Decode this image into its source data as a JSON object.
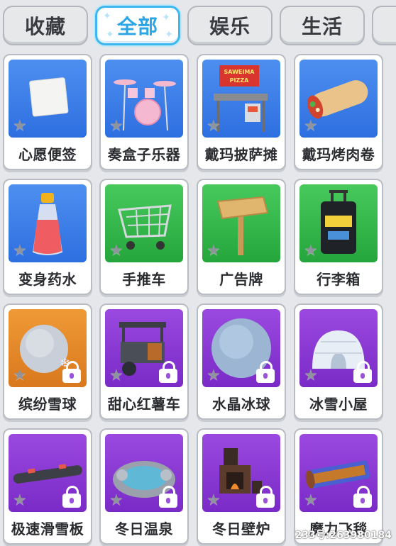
{
  "tabs": [
    {
      "label": "收藏",
      "active": false
    },
    {
      "label": "全部",
      "active": true
    },
    {
      "label": "娱乐",
      "active": false
    },
    {
      "label": "生活",
      "active": false
    }
  ],
  "items": [
    {
      "label": "心愿便签",
      "bg": "blue",
      "icon": "note-paper-icon",
      "locked": false
    },
    {
      "label": "奏盒子乐器",
      "bg": "blue",
      "icon": "drum-kit-icon",
      "locked": false
    },
    {
      "label": "戴玛披萨摊",
      "bg": "blue",
      "icon": "pizza-stand-icon",
      "locked": false,
      "sign_text": "SAWEIMA PIZZA"
    },
    {
      "label": "戴玛烤肉卷",
      "bg": "blue",
      "icon": "burrito-icon",
      "locked": false
    },
    {
      "label": "变身药水",
      "bg": "blue",
      "icon": "potion-bottle-icon",
      "locked": false
    },
    {
      "label": "手推车",
      "bg": "green",
      "icon": "shopping-cart-icon",
      "locked": false
    },
    {
      "label": "广告牌",
      "bg": "green",
      "icon": "signboard-icon",
      "locked": false
    },
    {
      "label": "行李箱",
      "bg": "green",
      "icon": "suitcase-icon",
      "locked": false
    },
    {
      "label": "缤纷雪球",
      "bg": "orange",
      "icon": "snowball-icon",
      "locked": true
    },
    {
      "label": "甜心红薯车",
      "bg": "purple",
      "icon": "sweet-potato-cart-icon",
      "locked": true
    },
    {
      "label": "水晶冰球",
      "bg": "purple",
      "icon": "crystal-ice-ball-icon",
      "locked": true
    },
    {
      "label": "冰雪小屋",
      "bg": "purple",
      "icon": "igloo-icon",
      "locked": true
    },
    {
      "label": "极速滑雪板",
      "bg": "purple",
      "icon": "snowboard-icon",
      "locked": true
    },
    {
      "label": "冬日温泉",
      "bg": "purple",
      "icon": "hot-spring-icon",
      "locked": true
    },
    {
      "label": "冬日壁炉",
      "bg": "purple",
      "icon": "fireplace-icon",
      "locked": true
    },
    {
      "label": "魔力飞毯",
      "bg": "purple",
      "icon": "magic-carpet-icon",
      "locked": true
    }
  ],
  "watermark": "233号:263980184"
}
